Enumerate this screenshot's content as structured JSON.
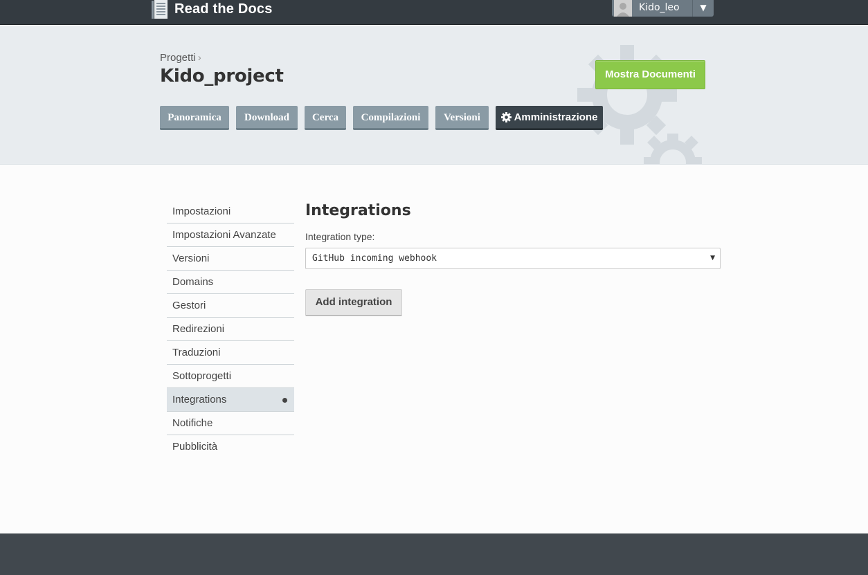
{
  "app": {
    "brand": "Read the Docs",
    "brand_icon": "book-icon"
  },
  "user_menu": {
    "username": "Kido_leo",
    "avatar_icon": "avatar-icon",
    "caret": "▼"
  },
  "header": {
    "breadcrumb_parent": "Progetti",
    "breadcrumb_sep": "›",
    "project_title": "Kido_project",
    "show_docs_label": "Mostra Documenti",
    "tabs": [
      {
        "label": "Panoramica"
      },
      {
        "label": "Download"
      },
      {
        "label": "Cerca"
      },
      {
        "label": "Compilazioni"
      },
      {
        "label": "Versioni"
      },
      {
        "label": "Amministrazione",
        "icon": "gear-icon",
        "active": true
      }
    ]
  },
  "sidebar": {
    "items": [
      {
        "label": "Impostazioni"
      },
      {
        "label": "Impostazioni Avanzate"
      },
      {
        "label": "Versioni"
      },
      {
        "label": "Domains"
      },
      {
        "label": "Gestori"
      },
      {
        "label": "Redirezioni"
      },
      {
        "label": "Traduzioni"
      },
      {
        "label": "Sottoprogetti"
      },
      {
        "label": "Integrations",
        "active": true
      },
      {
        "label": "Notifiche"
      },
      {
        "label": "Pubblicità"
      }
    ]
  },
  "main": {
    "title": "Integrations",
    "field_label": "Integration type:",
    "select_value": "GitHub incoming webhook",
    "select_arrow": "▼",
    "add_button_label": "Add integration"
  },
  "colors": {
    "topbar": "#343b41",
    "header_bg": "#e8ecef",
    "tab": "#8a9ba5",
    "tab_active": "#3a444b",
    "show_docs": "#8cc94a",
    "footer": "#41484e"
  }
}
